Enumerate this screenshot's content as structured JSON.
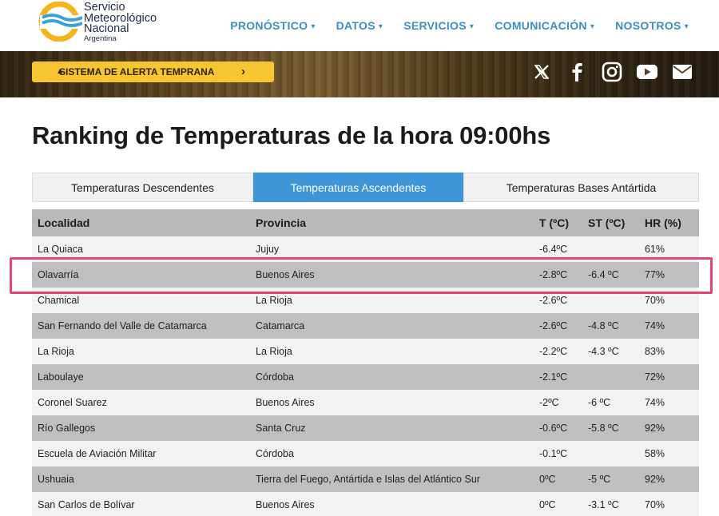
{
  "logo": {
    "line1": "Servicio",
    "line2": "Meteorológico",
    "line3": "Nacional",
    "line4": "Argentina"
  },
  "nav": {
    "items": [
      {
        "label": "PRONÓSTICO",
        "caret": "▾"
      },
      {
        "label": "DATOS",
        "caret": "▾"
      },
      {
        "label": "SERVICIOS",
        "caret": "▾"
      },
      {
        "label": "COMUNICACIÓN",
        "caret": "▾"
      },
      {
        "label": "NOSOTROS",
        "caret": "▾"
      }
    ]
  },
  "banner": {
    "alert_label": "SISTEMA DE ALERTA TEMPRANA",
    "alert_icon": "▲",
    "alert_chevron": "›",
    "socials": [
      "x-icon",
      "facebook-icon",
      "instagram-icon",
      "youtube-icon",
      "mail-icon"
    ]
  },
  "page": {
    "title": "Ranking de Temperaturas de la hora 09:00hs"
  },
  "tabs": [
    {
      "label": "Temperaturas Descendentes",
      "active": false
    },
    {
      "label": "Temperaturas Ascendentes",
      "active": true
    },
    {
      "label": "Temperaturas Bases Antártida",
      "active": false
    }
  ],
  "table": {
    "headers": [
      "Localidad",
      "Provincia",
      "T (ºC)",
      "ST (ºC)",
      "HR (%)"
    ],
    "rows": [
      [
        "La Quiaca",
        "Jujuy",
        "-6.4ºC",
        "",
        "61%"
      ],
      [
        "Olavarría",
        "Buenos Aires",
        "-2.8ºC",
        "-6.4 ºC",
        "77%"
      ],
      [
        "Chamical",
        "La Rioja",
        "-2.6ºC",
        "",
        "70%"
      ],
      [
        "San Fernando del Valle de Catamarca",
        "Catamarca",
        "-2.6ºC",
        "-4.8 ºC",
        "74%"
      ],
      [
        "La Rioja",
        "La Rioja",
        "-2.2ºC",
        "-4.3 ºC",
        "83%"
      ],
      [
        "Laboulaye",
        "Córdoba",
        "-2.1ºC",
        "",
        "72%"
      ],
      [
        "Coronel Suarez",
        "Buenos Aires",
        "-2ºC",
        "-6 ºC",
        "74%"
      ],
      [
        "Río Gallegos",
        "Santa Cruz",
        "-0.6ºC",
        "-5.8 ºC",
        "92%"
      ],
      [
        "Escuela de Aviación Militar",
        "Córdoba",
        "-0.1ºC",
        "",
        "58%"
      ],
      [
        "Ushuaia",
        "Tierra del Fuego, Antártida e Islas del Atlántico Sur",
        "0ºC",
        "-5 ºC",
        "92%"
      ],
      [
        "San Carlos de Bolívar",
        "Buenos Aires",
        "0ºC",
        "-3.1 ºC",
        "70%"
      ]
    ]
  },
  "colors": {
    "accent": "#3e95d8",
    "nav": "#3a8fc5",
    "alert": "#f7c531",
    "highlight": "#e0466f"
  }
}
